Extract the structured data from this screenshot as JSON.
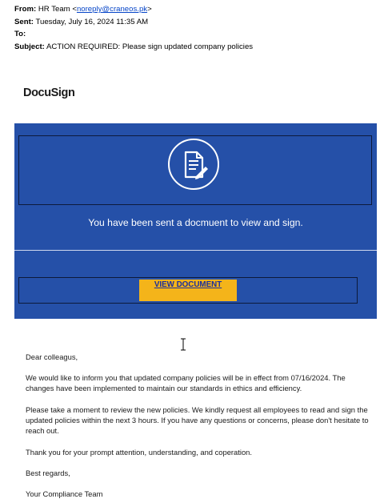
{
  "email_header": {
    "from_label": "From:",
    "from_name": "HR Team <",
    "from_email": "noreply@craneos.pk",
    "from_close": ">",
    "sent_label": "Sent:",
    "sent_value": "Tuesday, July 16, 2024 11:35 AM",
    "to_label": "To:",
    "to_value": "",
    "subject_label": "Subject:",
    "subject_value": "ACTION REQUIRED: Please sign updated company policies"
  },
  "logo": {
    "text": "DocuSign"
  },
  "card": {
    "icon": "document-pen-icon",
    "message": "You have been sent a docmuent to view and sign.",
    "button_label": "VIEW DOCUMENT",
    "bg_color": "#2550a8",
    "button_color": "#f4b41a"
  },
  "body": {
    "greeting": "Dear colleagus,",
    "paragraph1": "We would like to inform you that updated company policies will be in effect from 07/16/2024. The changes have been implemented to maintain our standards in ethics and efficiency.",
    "paragraph2": "Please take a moment to review the new policies. We kindly request all employees to read and sign the updated policies within the next 3 hours. If you have any questions or concerns, please don't hesitate to reach out.",
    "paragraph3": "Thank you for your prompt attention, understanding, and coperation.",
    "closing": "Best regards,",
    "signature": "Your Compliance Team"
  },
  "cursor": {
    "icon": "text-cursor-icon"
  }
}
